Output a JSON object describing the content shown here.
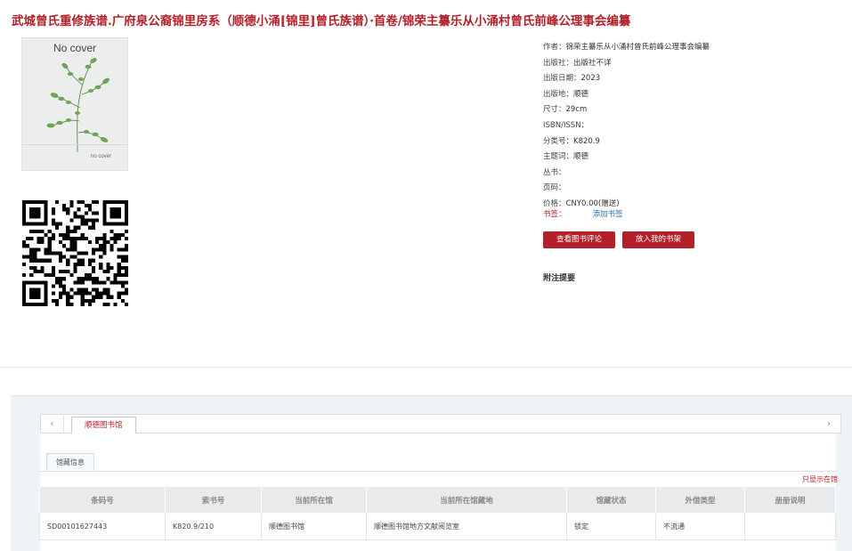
{
  "page": {
    "title": "武城曾氏重修族谱.广府泉公裔锦里房系（顺德小涌[锦里]曾氏族谱）·首卷/锦荣主纂乐从小涌村曾氏前峰公理事会编纂"
  },
  "cover": {
    "text": "No cover",
    "small_text": "no cover"
  },
  "meta": [
    {
      "label": "作者：",
      "value": "锦荣主纂乐从小涌村曾氏前峰公理事会编纂"
    },
    {
      "label": "出版社：",
      "value": "出版社不详"
    },
    {
      "label": "出版日期：",
      "value": "2023"
    },
    {
      "label": "出版地：",
      "value": "顺德"
    },
    {
      "label": "尺寸：",
      "value": "29cm"
    },
    {
      "label": "ISBN/ISSN：",
      "value": ""
    },
    {
      "label": "分类号：",
      "value": "K820.9"
    },
    {
      "label": "主题词：",
      "value": "顺德"
    },
    {
      "label": "丛书：",
      "value": ""
    },
    {
      "label": "页码：",
      "value": ""
    },
    {
      "label": "价格：",
      "value": "CNY0.00(赠送)"
    }
  ],
  "tags": {
    "label": "书签：",
    "add_link": "添加书签"
  },
  "buttons": {
    "review": "查看图书评论",
    "shelf": "放入我的书架"
  },
  "attach": {
    "label": "附注提要"
  },
  "holdings": {
    "library_tab": "顺德图书馆",
    "sub_tab": "馆藏信息",
    "only_show_link": "只显示在馆",
    "arrow_left": "‹",
    "arrow_right": "›",
    "columns": [
      "条码号",
      "索书号",
      "当前所在馆",
      "当前所在馆藏地",
      "馆藏状态",
      "外借类型",
      "册册说明"
    ],
    "rows": [
      [
        "SD00101627443",
        "K820.9/210",
        "顺德图书馆",
        "顺德图书馆地方文献阅览室",
        "锁定",
        "不流通",
        ""
      ]
    ]
  }
}
